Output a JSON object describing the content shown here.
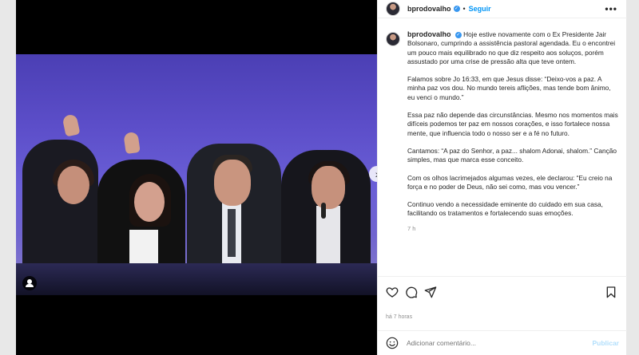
{
  "post": {
    "username": "bprodovalho",
    "follow_label": "Seguir",
    "separator": "•",
    "more_label": "•••",
    "caption_paragraphs": [
      "Hoje estive novamente com o Ex Presidente Jair Bolsonaro, cumprindo a assistência pastoral agendada. Eu o encontrei um pouco mais equilibrado no que diz respeito aos soluços, porém assustado por uma crise de pressão alta que teve ontem.",
      "Falamos sobre Jo 16:33, em que Jesus disse: “Deixo-vos a paz. A minha paz vos dou. No mundo tereis aflições, mas tende bom ânimo, eu venci o mundo.”",
      "Essa paz não depende das circunstâncias. Mesmo nos momentos mais difíceis podemos ter paz em nossos corações, e isso fortalece nossa mente, que influencia todo o nosso ser e a fé no futuro.",
      "Cantamos: “A paz do Senhor, a paz... shalom Adonai, shalom.” Canção simples, mas que marca esse conceito.",
      "Com os olhos lacrimejados algumas vezes, ele declarou: “Eu creio na força e no poder de Deus, não sei como, mas vou vencer.”",
      "Continuo vendo a necessidade eminente do cuidado em sua casa, facilitando os tratamentos e fortalecendo suas emoções."
    ],
    "caption_time": "7 h",
    "posted_ago": "há 7 horas",
    "comment_placeholder": "Adicionar comentário...",
    "publish_label": "Publicar"
  },
  "icons": {
    "verified": "verified-badge-icon",
    "next": "chevron-right-icon",
    "tag": "user-tag-icon",
    "like": "heart-icon",
    "comment": "comment-icon",
    "share": "send-icon",
    "save": "bookmark-icon",
    "emoji": "emoji-icon"
  },
  "colors": {
    "accent": "#0095f6",
    "verified": "#3897f0",
    "muted": "#8e8e8e",
    "publish_disabled": "#b2dffc"
  }
}
